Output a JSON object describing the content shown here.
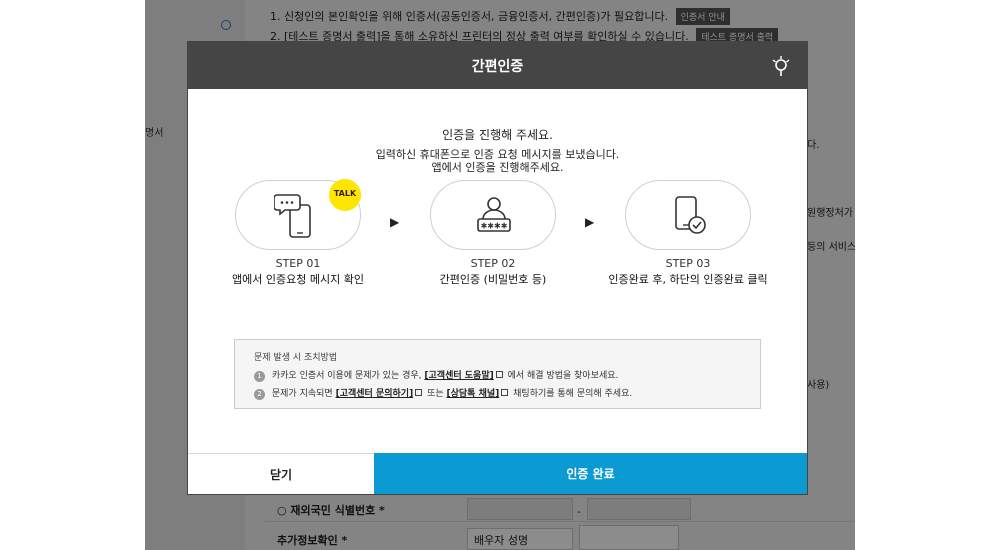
{
  "background": {
    "line1_text": "1. 신청인의 본인확인을 위해 인증서(공동인증서, 금융인증서, 간편인증)가 필요합니다.",
    "line1_chip": "인증서 안내",
    "line2_text": "2. [테스트 증명서 출력]을 통해 소유하신 프린터의 정상 출력 여부를 확인하실 수 있습니다.",
    "line2_chip": "테스트 증명서 출력",
    "side_label": "명서",
    "right_snippets": [
      "다.",
      "원행정처가 -",
      "등의 서비스를",
      "사용)"
    ],
    "field_foreigner": "○ 재외국민 식별번호 *",
    "field_extra": "추가정보확인 *",
    "select_value": "배우자 성명",
    "dash": "-"
  },
  "modal": {
    "title": "간편인증",
    "intro_line1": "인증을 진행해 주세요.",
    "intro_line2": "입력하신 휴대폰으로 인증 요청 메시지를 보냈습니다.",
    "intro_line3": "앱에서 인증을 진행해주세요.",
    "talk_badge": "TALK",
    "steps": [
      {
        "num": "STEP 01",
        "desc": "앱에서 인증요청 메시지 확인",
        "icon": "phone-message-icon"
      },
      {
        "num": "STEP 02",
        "desc": "간편인증 (비밀번호 등)",
        "icon": "user-password-icon"
      },
      {
        "num": "STEP 03",
        "desc": "인증완료 후, 하단의 인증완료 클릭",
        "icon": "phone-check-icon"
      }
    ],
    "arrow": "▶",
    "help": {
      "title": "문제 발생 시 조치방법",
      "item1_num": "1",
      "item1_pre": "카카오 인증서 이용에 문제가 있는 경우,",
      "item1_link": "[고객센터 도움말]",
      "item1_post": "에서 해결 방법을 찾아보세요.",
      "item2_num": "2",
      "item2_pre": "문제가 지속되면",
      "item2_link1": "[고객센터 문의하기]",
      "item2_mid": "또는",
      "item2_link2": "[상담톡 채널]",
      "item2_post": "채팅하기를 통해 문의해 주세요."
    },
    "close_button": "닫기",
    "done_button": "인증 완료"
  },
  "colors": {
    "header_bg": "#454545",
    "primary_button": "#0c9ad2",
    "kakao_yellow": "#ffe600"
  }
}
